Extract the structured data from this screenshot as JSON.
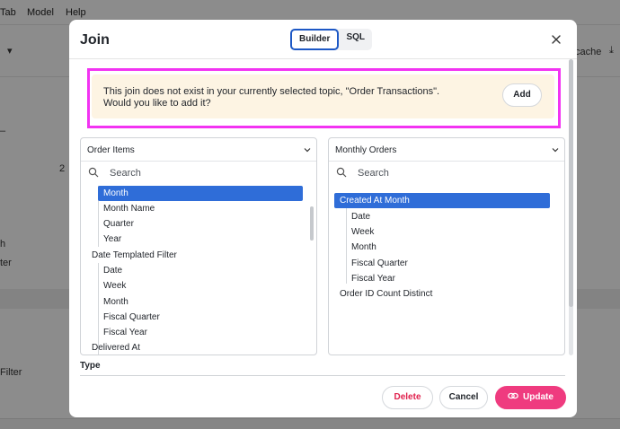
{
  "background": {
    "menu": [
      "Tab",
      "Model",
      "Help"
    ],
    "toolbar_right": "cache",
    "side_numbers": [
      "2"
    ],
    "side_fragments": [
      "h",
      "ter",
      "Filter"
    ]
  },
  "modal": {
    "title": "Join",
    "tabs": [
      {
        "label": "Builder",
        "active": true
      },
      {
        "label": "SQL",
        "active": false
      }
    ],
    "notice": {
      "text": "This join does not exist in your currently selected topic, \"Order Transactions\".\nWould you like to add it?",
      "add_label": "Add"
    },
    "left_panel": {
      "selected_view": "Order Items",
      "search_placeholder": "Search",
      "items": [
        {
          "label": "Month",
          "level": 1,
          "selected": true
        },
        {
          "label": "Month Name",
          "level": 1
        },
        {
          "label": "Quarter",
          "level": 1
        },
        {
          "label": "Year",
          "level": 1
        },
        {
          "label": "Date Templated Filter",
          "level": 0
        },
        {
          "label": "Date",
          "level": 1
        },
        {
          "label": "Week",
          "level": 1
        },
        {
          "label": "Month",
          "level": 1
        },
        {
          "label": "Fiscal Quarter",
          "level": 1
        },
        {
          "label": "Fiscal Year",
          "level": 1
        },
        {
          "label": "Delivered At",
          "level": 0
        }
      ]
    },
    "right_panel": {
      "selected_view": "Monthly Orders",
      "search_placeholder": "Search",
      "items": [
        {
          "label": "Created At Month",
          "level": 0,
          "selected": true
        },
        {
          "label": "Date",
          "level": 1
        },
        {
          "label": "Week",
          "level": 1
        },
        {
          "label": "Month",
          "level": 1
        },
        {
          "label": "Fiscal Quarter",
          "level": 1
        },
        {
          "label": "Fiscal Year",
          "level": 1
        },
        {
          "label": "Order ID Count Distinct",
          "level": 0
        }
      ]
    },
    "type_label": "Type",
    "buttons": {
      "delete": "Delete",
      "cancel": "Cancel",
      "update": "Update"
    }
  },
  "colors": {
    "accent": "#1d58c5",
    "selection": "#2f6dd8",
    "primary_button": "#ef3b7f",
    "danger_text": "#e0224e",
    "notice_bg": "#fdf4e3",
    "highlight_border": "#f233f2"
  },
  "icons": {
    "close": "close-icon",
    "search": "search-icon",
    "dropdown": "chevron-down-icon",
    "update": "link-icon"
  }
}
